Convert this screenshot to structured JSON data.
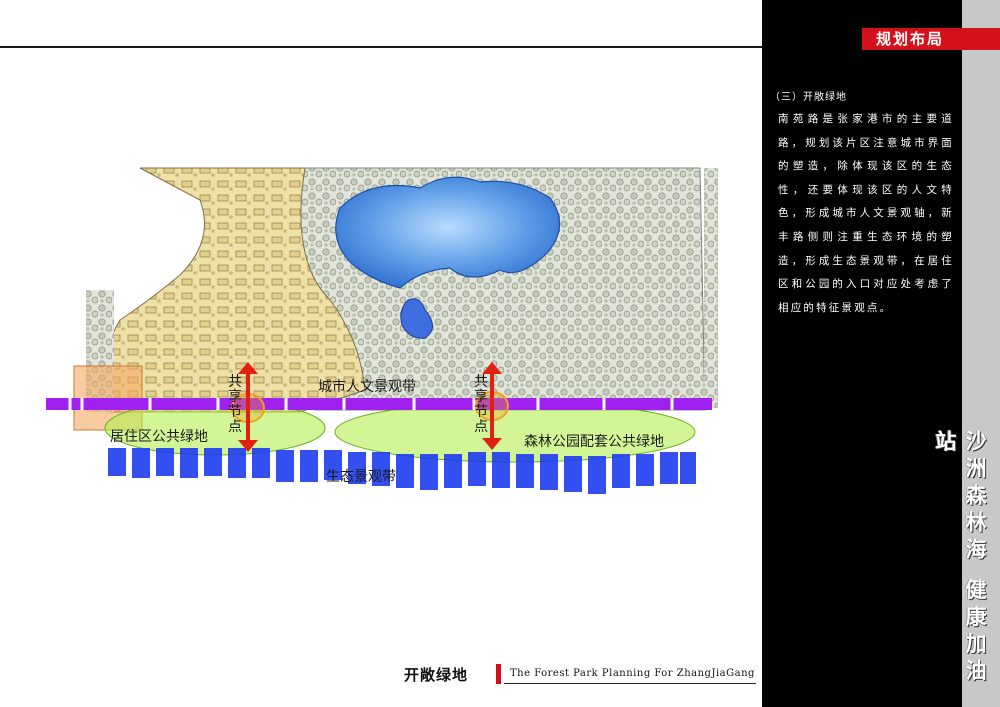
{
  "header": {
    "section_tag": "规划布局"
  },
  "panel": {
    "subheading": "（三）开敞绿地",
    "description": "南苑路是张家港市的主要道路，规划该片区注意城市界面的塑造，除体现该区的生态性，还要体现该区的人文特色，形成城市人文景观轴，新丰路侧则注重生态环境的塑造，形成生态景观带，在居住区和公园的入口对应处考虑了相应的特征景观点。",
    "slogan": "沙洲森林海 健康加油站"
  },
  "map": {
    "labels": {
      "urban_axis": "城市人文景观带",
      "residential_green": "居住区公共绿地",
      "park_green": "森林公园配套公共绿地",
      "eco_band": "生态景观带",
      "node_left": "共享节点",
      "node_right": "共享节点"
    },
    "colors": {
      "urban_axis": "#a020f0",
      "eco_band": "#1e3cf0",
      "green_zone": "#b4f050",
      "node_arrow": "#e02010",
      "node_circle": "#f0a020",
      "residential": "#f0e0a0",
      "lake": "#4a8ee8"
    }
  },
  "footer": {
    "title": "开敞绿地",
    "subtitle": "The Forest Park Planning For ZhangJiaGang"
  }
}
